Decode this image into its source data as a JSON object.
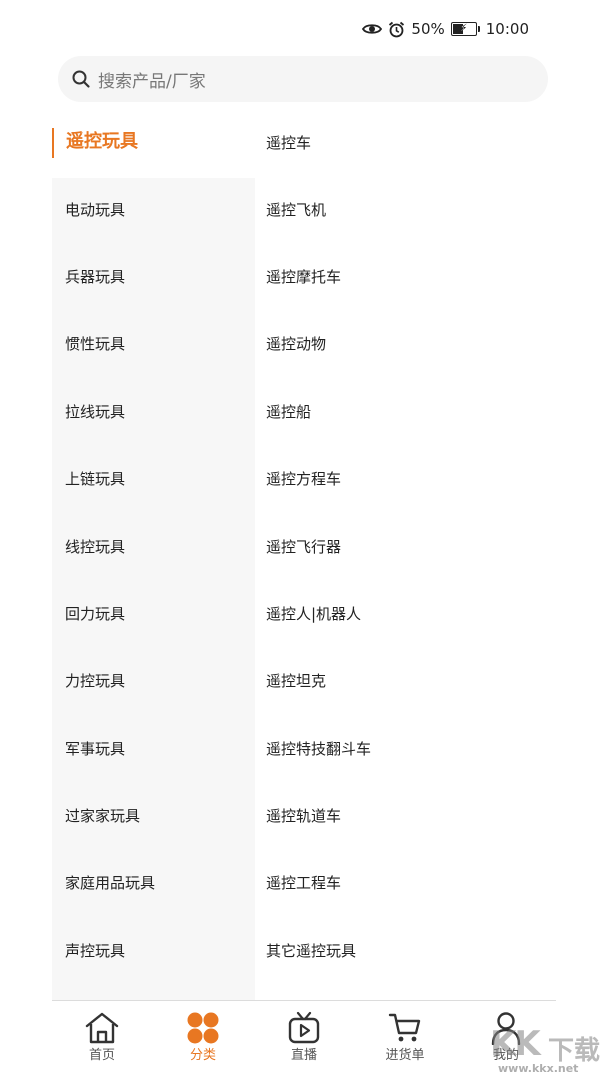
{
  "status_bar": {
    "icons": [
      "eye-icon",
      "alarm-icon",
      "battery-icon"
    ],
    "battery": "50%",
    "battery_level": 0.5,
    "time": "10:00"
  },
  "search": {
    "placeholder": "搜索产品/厂家"
  },
  "categories": [
    {
      "label": "遥控玩具",
      "active": true
    },
    {
      "label": "电动玩具"
    },
    {
      "label": "兵器玩具"
    },
    {
      "label": "惯性玩具"
    },
    {
      "label": "拉线玩具"
    },
    {
      "label": "上链玩具"
    },
    {
      "label": "线控玩具"
    },
    {
      "label": "回力玩具"
    },
    {
      "label": "力控玩具"
    },
    {
      "label": "军事玩具"
    },
    {
      "label": "过家家玩具"
    },
    {
      "label": "家庭用品玩具"
    },
    {
      "label": "声控玩具"
    }
  ],
  "subcategories": [
    "遥控车",
    "遥控飞机",
    "遥控摩托车",
    "遥控动物",
    "遥控船",
    "遥控方程车",
    "遥控飞行器",
    "遥控人|机器人",
    "遥控坦克",
    "遥控特技翻斗车",
    "遥控轨道车",
    "遥控工程车",
    "其它遥控玩具"
  ],
  "bottom_nav": [
    {
      "label": "首页",
      "icon": "home-icon"
    },
    {
      "label": "分类",
      "icon": "category-icon",
      "active": true
    },
    {
      "label": "直播",
      "icon": "live-tv-icon"
    },
    {
      "label": "进货单",
      "icon": "cart-icon"
    },
    {
      "label": "我的",
      "icon": "profile-icon"
    }
  ],
  "watermark": {
    "logo": "KK下载",
    "url": "www.kkx.net"
  },
  "colors": {
    "accent": "#e87722",
    "left_column_bg": "#f7f7f7",
    "search_bg": "#f5f5f5"
  }
}
